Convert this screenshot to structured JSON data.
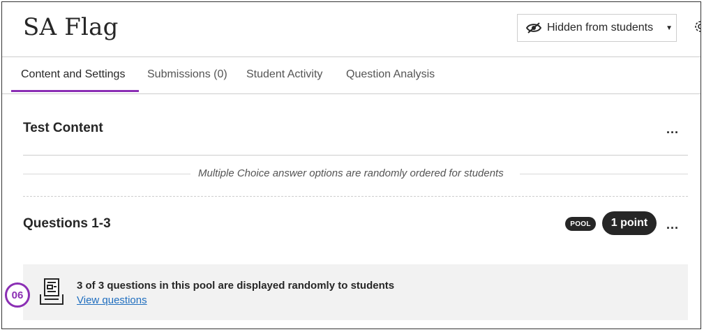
{
  "page": {
    "title": "SA Flag",
    "visibility_label": "Hidden from students"
  },
  "tabs": [
    {
      "label": "Content and Settings"
    },
    {
      "label": "Submissions (0)"
    },
    {
      "label": "Student Activity"
    },
    {
      "label": "Question Analysis"
    }
  ],
  "test_content": {
    "title": "Test Content",
    "more_label": "...",
    "note": "Multiple Choice answer options are randomly ordered for students"
  },
  "questions": {
    "title": "Questions 1-3",
    "pool_badge": "POOL",
    "points_badge": "1 point",
    "more_label": "...",
    "pool_text": "3 of 3 questions in this pool are displayed randomly to students",
    "view_link": "View questions"
  },
  "step_badge": "06",
  "colors": {
    "accent": "#8b2fb4",
    "link": "#1f6ebf",
    "badge_bg": "#262626",
    "panel_bg": "#f2f2f2"
  },
  "icons": {
    "visibility": "eye-slash-icon",
    "dropdown": "caret-down-icon",
    "settings": "gear-icon",
    "pool": "question-pool-icon"
  }
}
